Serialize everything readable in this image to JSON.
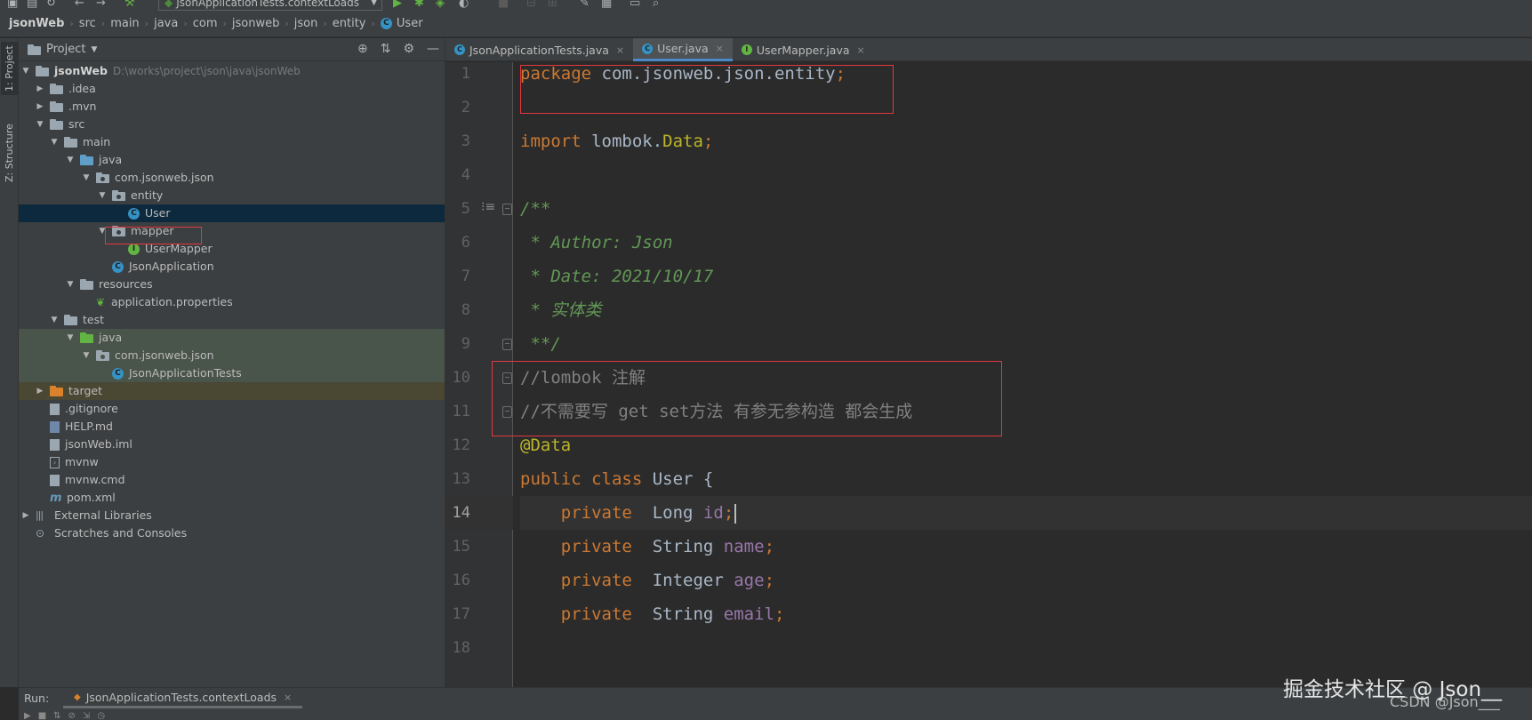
{
  "toolbar": {
    "run_config": "JsonApplicationTests.contextLoads",
    "icons": [
      "save-icon",
      "sync-icon",
      "back-icon",
      "forward-icon",
      "build-icon",
      "run-icon",
      "debug-icon",
      "coverage-icon",
      "stop-icon",
      "settings-icon",
      "structure-icon",
      "search-icon"
    ]
  },
  "breadcrumb": {
    "items": [
      "jsonWeb",
      "src",
      "main",
      "java",
      "com",
      "jsonweb",
      "json",
      "entity",
      "User"
    ]
  },
  "tool_strip": {
    "project_tab": "1: Project",
    "structure_tab": "Z: Structure"
  },
  "project_panel": {
    "title": "Project",
    "tree": [
      {
        "label": "jsonWeb",
        "path": "D:\\works\\project\\json\\java\\jsonWeb"
      },
      {
        "label": ".idea"
      },
      {
        "label": ".mvn"
      },
      {
        "label": "src"
      },
      {
        "label": "main"
      },
      {
        "label": "java"
      },
      {
        "label": "com.jsonweb.json"
      },
      {
        "label": "entity"
      },
      {
        "label": "User"
      },
      {
        "label": "mapper"
      },
      {
        "label": "UserMapper"
      },
      {
        "label": "JsonApplication"
      },
      {
        "label": "resources"
      },
      {
        "label": "application.properties"
      },
      {
        "label": "test"
      },
      {
        "label": "java"
      },
      {
        "label": "com.jsonweb.json"
      },
      {
        "label": "JsonApplicationTests"
      },
      {
        "label": "target"
      },
      {
        "label": ".gitignore"
      },
      {
        "label": "HELP.md"
      },
      {
        "label": "jsonWeb.iml"
      },
      {
        "label": "mvnw"
      },
      {
        "label": "mvnw.cmd"
      },
      {
        "label": "pom.xml"
      },
      {
        "label": "External Libraries"
      },
      {
        "label": "Scratches and Consoles"
      }
    ]
  },
  "editor_tabs": [
    {
      "label": "JsonApplicationTests.java",
      "icon": "class-icon"
    },
    {
      "label": "User.java",
      "icon": "class-icon",
      "active": true
    },
    {
      "label": "UserMapper.java",
      "icon": "interface-icon"
    }
  ],
  "editor": {
    "current_line": 14,
    "line_numbers": [
      "1",
      "2",
      "3",
      "4",
      "5",
      "6",
      "7",
      "8",
      "9",
      "10",
      "11",
      "12",
      "13",
      "14",
      "15",
      "16",
      "17",
      "18"
    ],
    "lines": [
      {
        "package_kw": "package",
        "package_name": " com.jsonweb.json.entity",
        "semicolon": ";"
      },
      {},
      {
        "import_kw": "import",
        "import_pkg": " lombok.",
        "import_cls": "Data",
        "semicolon": ";"
      },
      {},
      {
        "doc": "/**"
      },
      {
        "doc": " * Author: Json"
      },
      {
        "doc": " * Date: 2021/10/17"
      },
      {
        "doc": " * 实体类"
      },
      {
        "doc": " **/"
      },
      {
        "comment": "//lombok 注解"
      },
      {
        "comment": "//不需要写 get set方法 有参无参构造 都会生成"
      },
      {
        "annotation": "@Data"
      },
      {
        "public_kw": "public",
        "class_kw": " class",
        "class_name": " User {"
      },
      {
        "indent": "    ",
        "modifier": "private",
        "type": "  Long ",
        "field": "id",
        "semicolon": ";"
      },
      {
        "indent": "    ",
        "modifier": "private",
        "type": "  String ",
        "field": "name",
        "semicolon": ";"
      },
      {
        "indent": "    ",
        "modifier": "private",
        "type": "  Integer ",
        "field": "age",
        "semicolon": ";"
      },
      {
        "indent": "    ",
        "modifier": "private",
        "type": "  String ",
        "field": "email",
        "semicolon": ";"
      },
      {}
    ]
  },
  "run_bar": {
    "label": "Run:",
    "tab": "JsonApplicationTests.contextLoads"
  },
  "watermark": {
    "main": "掘金技术社区 @ Json__",
    "sub": "CSDN @Json___"
  },
  "colors": {
    "highlight_box": "#e0393e",
    "keyword": "#cc7832",
    "annotation": "#bbb529",
    "field": "#9876aa",
    "doc_comment": "#629755",
    "line_comment": "#808080"
  }
}
